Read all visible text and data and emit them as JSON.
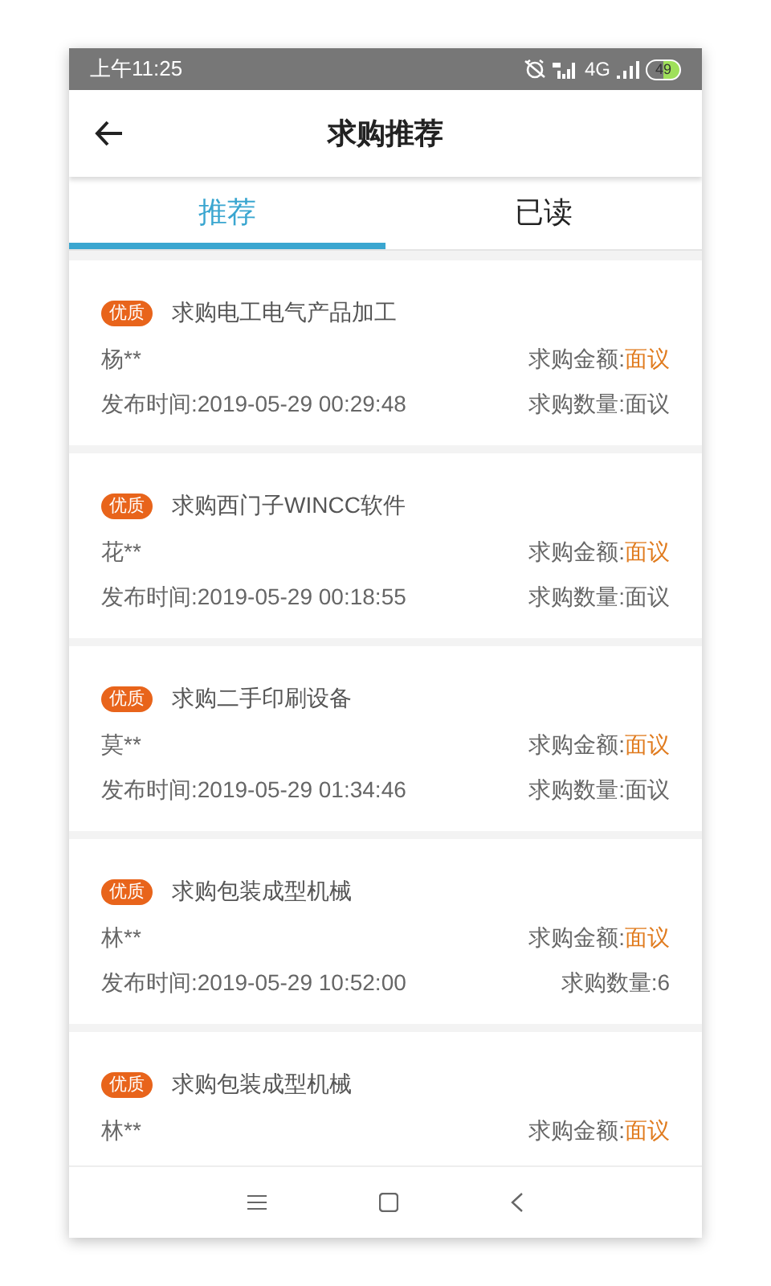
{
  "status_bar": {
    "time": "上午11:25",
    "network": "4G",
    "battery": "49"
  },
  "header": {
    "title": "求购推荐"
  },
  "tabs": [
    {
      "label": "推荐",
      "selected": true
    },
    {
      "label": "已读",
      "selected": false
    }
  ],
  "items": [
    {
      "badge": "优质",
      "title": "求购电工电气产品加工",
      "buyer": "杨**",
      "amount_label": "求购金额:",
      "amount": "面议",
      "time": "发布时间:2019-05-29 00:29:48",
      "quantity": "求购数量:面议"
    },
    {
      "badge": "优质",
      "title": "求购西门子WINCC软件",
      "buyer": "花**",
      "amount_label": "求购金额:",
      "amount": "面议",
      "time": "发布时间:2019-05-29 00:18:55",
      "quantity": "求购数量:面议"
    },
    {
      "badge": "优质",
      "title": "求购二手印刷设备",
      "buyer": "莫**",
      "amount_label": "求购金额:",
      "amount": "面议",
      "time": "发布时间:2019-05-29 01:34:46",
      "quantity": "求购数量:面议"
    },
    {
      "badge": "优质",
      "title": "求购包装成型机械",
      "buyer": "林**",
      "amount_label": "求购金额:",
      "amount": "面议",
      "time": "发布时间:2019-05-29 10:52:00",
      "quantity": "求购数量:6"
    },
    {
      "badge": "优质",
      "title": "求购包装成型机械",
      "buyer": "林**",
      "amount_label": "求购金额:",
      "amount": "面议"
    }
  ]
}
